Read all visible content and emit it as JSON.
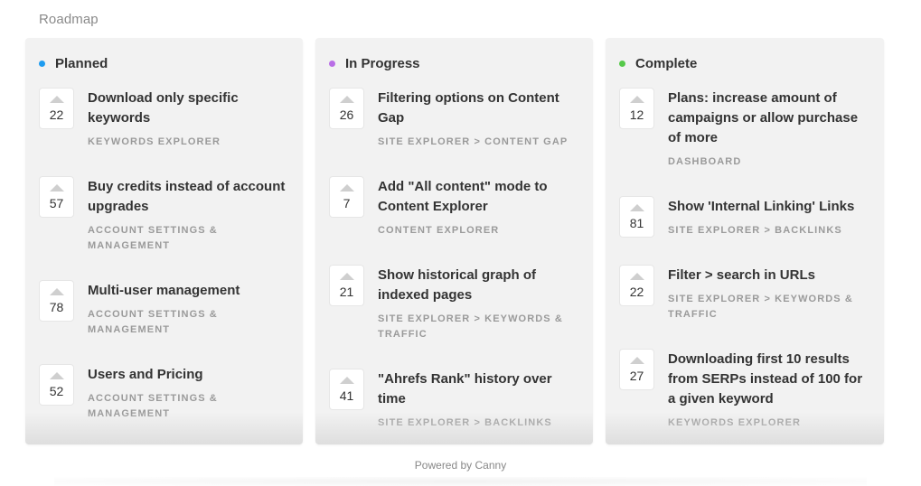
{
  "header": {
    "title": "Roadmap"
  },
  "footer": {
    "powered_by": "Powered by Canny"
  },
  "columns": [
    {
      "title": "Planned",
      "dot_color": "#1e9cf0",
      "posts": [
        {
          "votes": "22",
          "title": "Download only specific keywords",
          "category": "Keywords Explorer"
        },
        {
          "votes": "57",
          "title": "Buy credits instead of account upgrades",
          "category": "Account Settings & Management"
        },
        {
          "votes": "78",
          "title": "Multi-user management",
          "category": "Account Settings & Management"
        },
        {
          "votes": "52",
          "title": "Users and Pricing",
          "category": "Account Settings & Management"
        }
      ]
    },
    {
      "title": "In Progress",
      "dot_color": "#b96ee6",
      "posts": [
        {
          "votes": "26",
          "title": "Filtering options on Content Gap",
          "category": "Site Explorer > Content Gap"
        },
        {
          "votes": "7",
          "title": "Add \"All content\" mode to Content Explorer",
          "category": "Content Explorer"
        },
        {
          "votes": "21",
          "title": "Show historical graph of indexed pages",
          "category": "Site Explorer > Keywords & Traffic"
        },
        {
          "votes": "41",
          "title": "\"Ahrefs Rank\" history over time",
          "category": "Site Explorer > Backlinks"
        }
      ]
    },
    {
      "title": "Complete",
      "dot_color": "#56c94a",
      "posts": [
        {
          "votes": "12",
          "title": "Plans: increase amount of campaigns or allow purchase of more",
          "category": "Dashboard"
        },
        {
          "votes": "81",
          "title": "Show 'Internal Linking' Links",
          "category": "Site Explorer > Backlinks"
        },
        {
          "votes": "22",
          "title": "Filter > search in URLs",
          "category": "Site Explorer > Keywords & Traffic"
        },
        {
          "votes": "27",
          "title": "Downloading first 10 results from SERPs instead of 100 for a given keyword",
          "category": "Keywords Explorer"
        }
      ]
    }
  ]
}
